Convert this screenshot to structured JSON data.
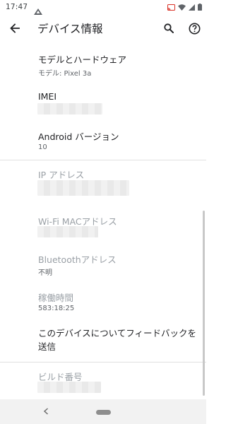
{
  "status_bar": {
    "time": "17:47",
    "icons": [
      "drive-upload-icon",
      "cast-icon",
      "wifi-icon",
      "cellular-signal-icon",
      "battery-icon"
    ]
  },
  "app_bar": {
    "title": "デバイス情報",
    "icons": [
      "back-arrow-icon",
      "search-icon",
      "help-icon"
    ]
  },
  "items": [
    {
      "title": "モデルとハードウェア",
      "subtitle": "モデル: Pixel 3a"
    },
    {
      "title": "IMEI",
      "subtitle_redacted": true
    },
    {
      "title": "Android バージョン",
      "subtitle": "10"
    },
    {
      "title": "IP アドレス",
      "subtitle_redacted": true,
      "disabled": true
    },
    {
      "title": "Wi-Fi MACアドレス",
      "subtitle_redacted": true,
      "disabled": true
    },
    {
      "title": "Bluetoothアドレス",
      "subtitle": "不明",
      "disabled": true
    },
    {
      "title": "稼働時間",
      "subtitle": "583:18:25",
      "disabled": true
    },
    {
      "title": "このデバイスについてフィードバックを送信"
    },
    {
      "title": "ビルド番号",
      "subtitle_redacted": true,
      "disabled": true
    }
  ],
  "nav_bar": {
    "icons": [
      "nav-back-icon",
      "home-pill-icon"
    ]
  }
}
